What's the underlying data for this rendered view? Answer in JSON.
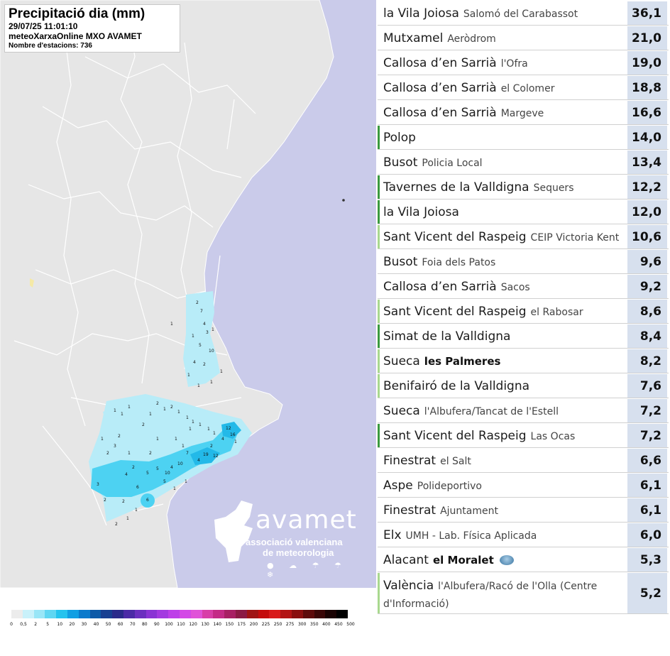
{
  "map": {
    "title": "Precipitació dia (mm)",
    "datetime": "29/07/25 11:01:10",
    "source": "meteoXarxaOnline MXO AVAMET",
    "stations_count": "Nombre d'estacions: 736",
    "logo": {
      "word": "avamet",
      "line1": "associació valenciana",
      "line2": "de meteorologia"
    },
    "legend": {
      "labels": [
        "0",
        "0,5",
        "2",
        "5",
        "10",
        "20",
        "30",
        "40",
        "50",
        "60",
        "70",
        "80",
        "90",
        "100",
        "110",
        "120",
        "130",
        "140",
        "150",
        "175",
        "200",
        "225",
        "250",
        "275",
        "300",
        "350",
        "400",
        "450",
        "500"
      ],
      "colors": [
        "#ececec",
        "#c9f1fa",
        "#99e6f7",
        "#5fd6f2",
        "#25c3ee",
        "#119fe3",
        "#0a7acc",
        "#0d5aa8",
        "#173f91",
        "#2a2a8a",
        "#4b2aa6",
        "#6b2fbf",
        "#8a34d4",
        "#a33ae0",
        "#bd3fe8",
        "#d348e6",
        "#e052d8",
        "#d83ea8",
        "#c42a86",
        "#a81f63",
        "#8b1a44",
        "#a01414",
        "#c40c0c",
        "#d81a1a",
        "#b31414",
        "#8a0f0f",
        "#5d0b0b",
        "#3a0707",
        "#1a0303",
        "#000000"
      ]
    },
    "colors": {
      "sea": "#cacbea",
      "land": "#e6e6e6",
      "outside_land": "#f2f2f2",
      "border": "#ffffff",
      "rain_light": "#b8ecf8",
      "rain_mid": "#4dd2f2",
      "rain_strong": "#23b9e8"
    }
  },
  "stations": [
    {
      "town": "la Vila Joiosa",
      "site": "Salomó del Carabassot",
      "value": "36,1",
      "mark": "none"
    },
    {
      "town": "Mutxamel",
      "site": "Aeròdrom",
      "value": "21,0",
      "mark": "none"
    },
    {
      "town": "Callosa d’en Sarrià",
      "site": "l'Ofra",
      "value": "19,0",
      "mark": "none"
    },
    {
      "town": "Callosa d’en Sarrià",
      "site": "el Colomer",
      "value": "18,8",
      "mark": "none"
    },
    {
      "town": "Callosa d’en Sarrià",
      "site": "Margeve",
      "value": "16,6",
      "mark": "none"
    },
    {
      "town": "Polop",
      "site": "",
      "value": "14,0",
      "mark": "dark"
    },
    {
      "town": "Busot",
      "site": "Policia Local",
      "value": "13,4",
      "mark": "none"
    },
    {
      "town": "Tavernes de la Valldigna",
      "site": "Sequers",
      "value": "12,2",
      "mark": "dark"
    },
    {
      "town": "la Vila Joiosa",
      "site": "",
      "value": "12,0",
      "mark": "dark"
    },
    {
      "town": "Sant Vicent del Raspeig",
      "site": "CEIP Victoria Kent",
      "value": "10,6",
      "mark": "light"
    },
    {
      "town": "Busot",
      "site": "Foia dels Patos",
      "value": "9,6",
      "mark": "none"
    },
    {
      "town": "Callosa d’en Sarrià",
      "site": "Sacos",
      "value": "9,2",
      "mark": "none"
    },
    {
      "town": "Sant Vicent del Raspeig",
      "site": "el Rabosar",
      "value": "8,6",
      "mark": "light"
    },
    {
      "town": "Simat de la Valldigna",
      "site": "",
      "value": "8,4",
      "mark": "dark"
    },
    {
      "town": "Sueca",
      "site": "les Palmeres",
      "value": "8,2",
      "mark": "light",
      "site_bold": true
    },
    {
      "town": "Benifairó de la Valldigna",
      "site": "",
      "value": "7,6",
      "mark": "light"
    },
    {
      "town": "Sueca",
      "site": "l'Albufera/Tancat de l'Estell",
      "value": "7,2",
      "mark": "none"
    },
    {
      "town": "Sant Vicent del Raspeig",
      "site": "Las Ocas",
      "value": "7,2",
      "mark": "dark"
    },
    {
      "town": "Finestrat",
      "site": "el Salt",
      "value": "6,6",
      "mark": "none"
    },
    {
      "town": "Aspe",
      "site": "Polideportivo",
      "value": "6,1",
      "mark": "none"
    },
    {
      "town": "Finestrat",
      "site": "Ajuntament",
      "value": "6,1",
      "mark": "none"
    },
    {
      "town": "Elx",
      "site": "UMH - Lab. Física Aplicada",
      "value": "6,0",
      "mark": "none"
    },
    {
      "town": "Alacant",
      "site": "el Moralet",
      "value": "5,3",
      "mark": "none",
      "site_bold": true,
      "icon": "globe-icon"
    },
    {
      "town": "València",
      "site": "l'Albufera/Racó de l'Olla (Centre d'Informació)",
      "value": "5,2",
      "mark": "light"
    }
  ]
}
